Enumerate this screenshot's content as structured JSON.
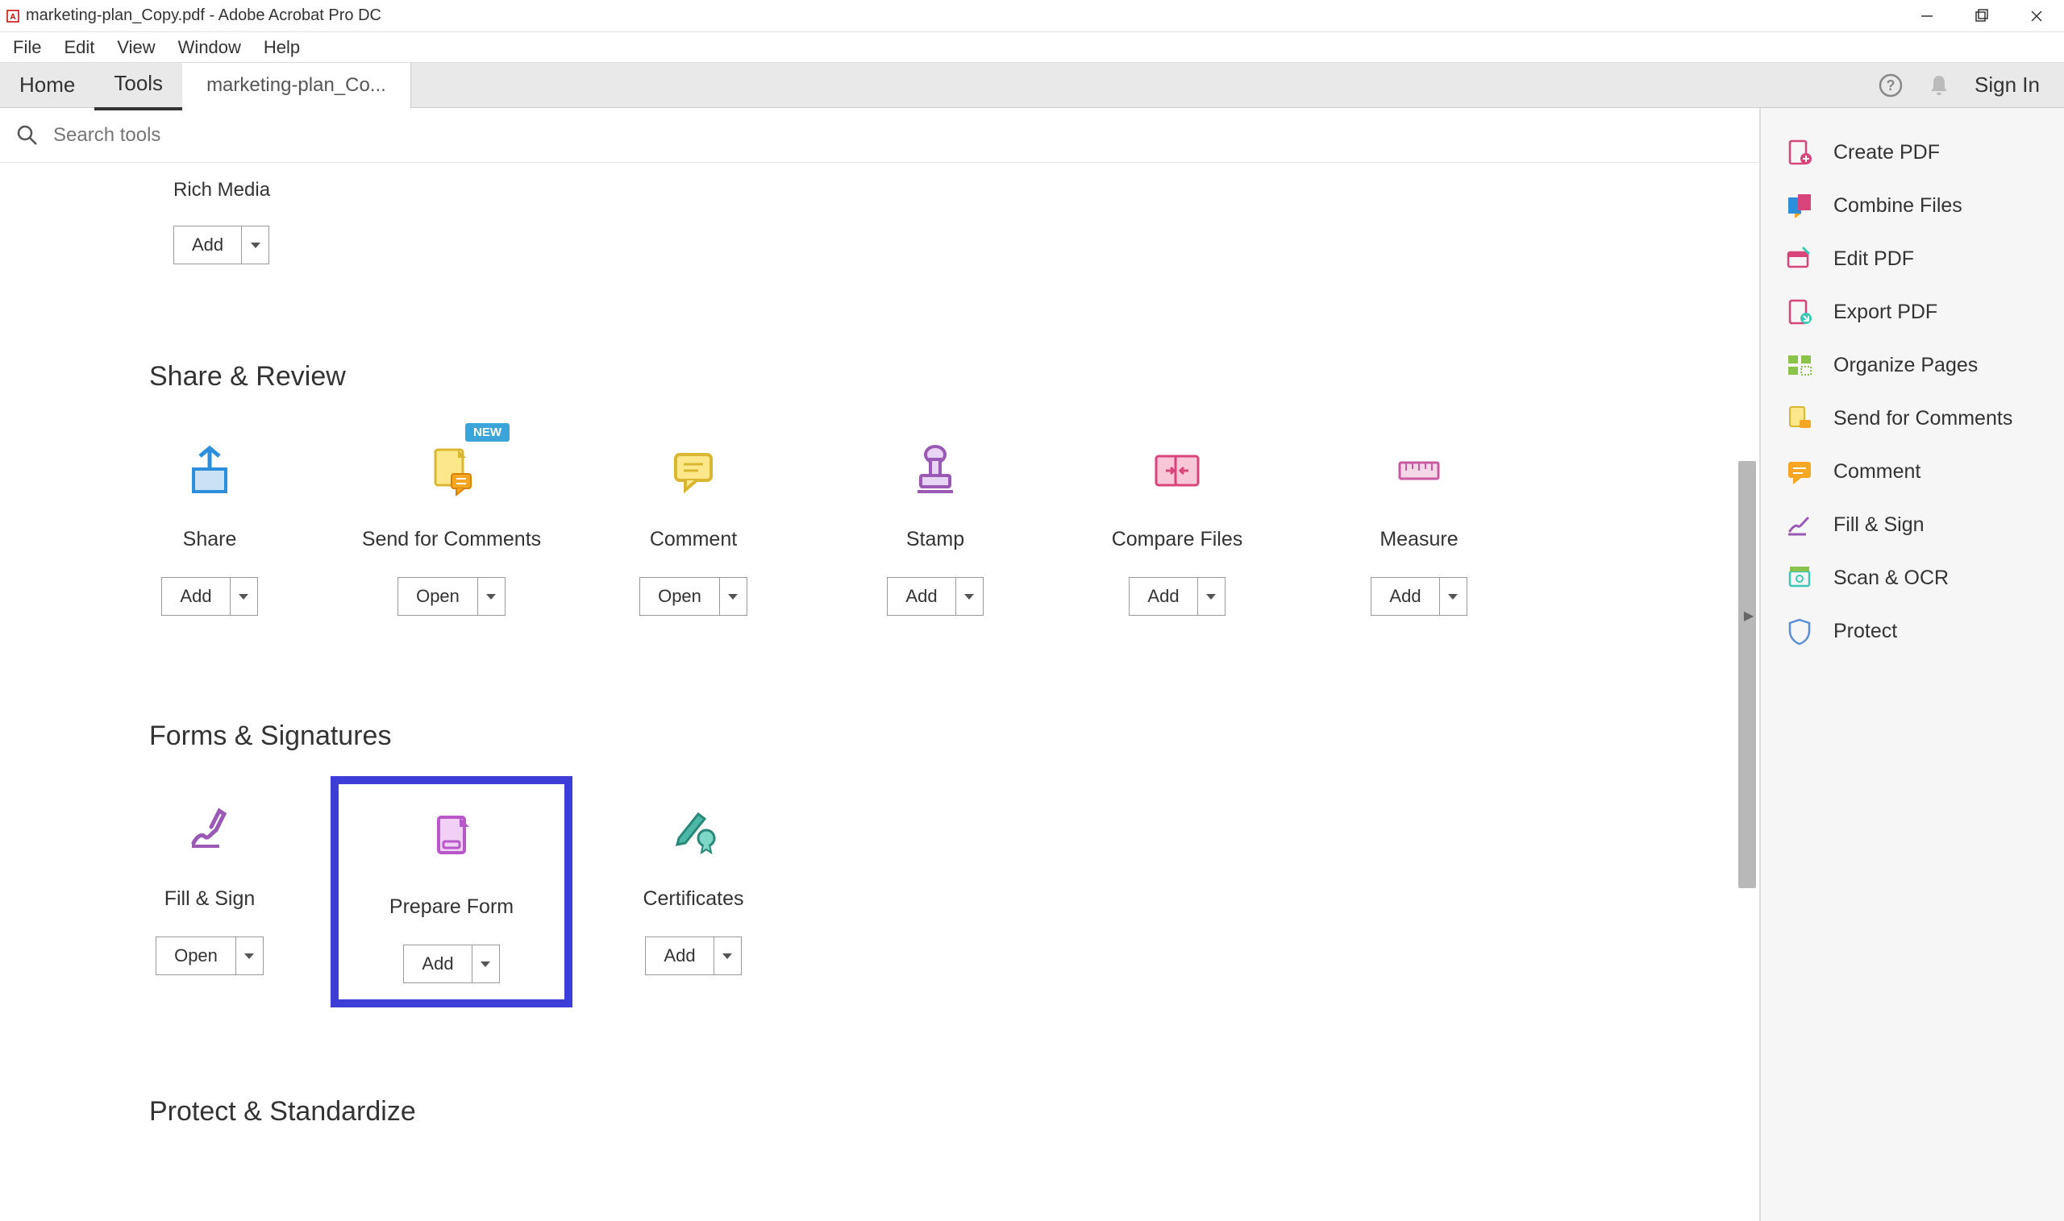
{
  "window": {
    "title": "marketing-plan_Copy.pdf - Adobe Acrobat Pro DC"
  },
  "menu": [
    "File",
    "Edit",
    "View",
    "Window",
    "Help"
  ],
  "tabs": {
    "home": "Home",
    "tools": "Tools",
    "doc": "marketing-plan_Co..."
  },
  "sign_in": "Sign In",
  "search": {
    "placeholder": "Search tools"
  },
  "partial_tool": {
    "label": "Rich Media",
    "btn": "Add"
  },
  "sections": {
    "share_review": {
      "title": "Share & Review",
      "tools": [
        {
          "label": "Share",
          "btn": "Add",
          "icon": "share",
          "new": false
        },
        {
          "label": "Send for Comments",
          "btn": "Open",
          "icon": "send-comments",
          "new": true
        },
        {
          "label": "Comment",
          "btn": "Open",
          "icon": "comment",
          "new": false
        },
        {
          "label": "Stamp",
          "btn": "Add",
          "icon": "stamp",
          "new": false
        },
        {
          "label": "Compare Files",
          "btn": "Add",
          "icon": "compare",
          "new": false
        },
        {
          "label": "Measure",
          "btn": "Add",
          "icon": "measure",
          "new": false
        }
      ]
    },
    "forms_signatures": {
      "title": "Forms & Signatures",
      "tools": [
        {
          "label": "Fill & Sign",
          "btn": "Open",
          "icon": "fill-sign",
          "highlighted": false
        },
        {
          "label": "Prepare Form",
          "btn": "Add",
          "icon": "prepare-form",
          "highlighted": true
        },
        {
          "label": "Certificates",
          "btn": "Add",
          "icon": "certificates",
          "highlighted": false
        }
      ]
    },
    "protect_standardize": {
      "title": "Protect & Standardize"
    }
  },
  "badge_new": "NEW",
  "sidebar": [
    {
      "label": "Create PDF",
      "icon": "create-pdf"
    },
    {
      "label": "Combine Files",
      "icon": "combine"
    },
    {
      "label": "Edit PDF",
      "icon": "edit-pdf"
    },
    {
      "label": "Export PDF",
      "icon": "export-pdf"
    },
    {
      "label": "Organize Pages",
      "icon": "organize"
    },
    {
      "label": "Send for Comments",
      "icon": "send-comments-side"
    },
    {
      "label": "Comment",
      "icon": "comment-side"
    },
    {
      "label": "Fill & Sign",
      "icon": "fill-sign-side"
    },
    {
      "label": "Scan & OCR",
      "icon": "scan-ocr"
    },
    {
      "label": "Protect",
      "icon": "protect"
    }
  ]
}
